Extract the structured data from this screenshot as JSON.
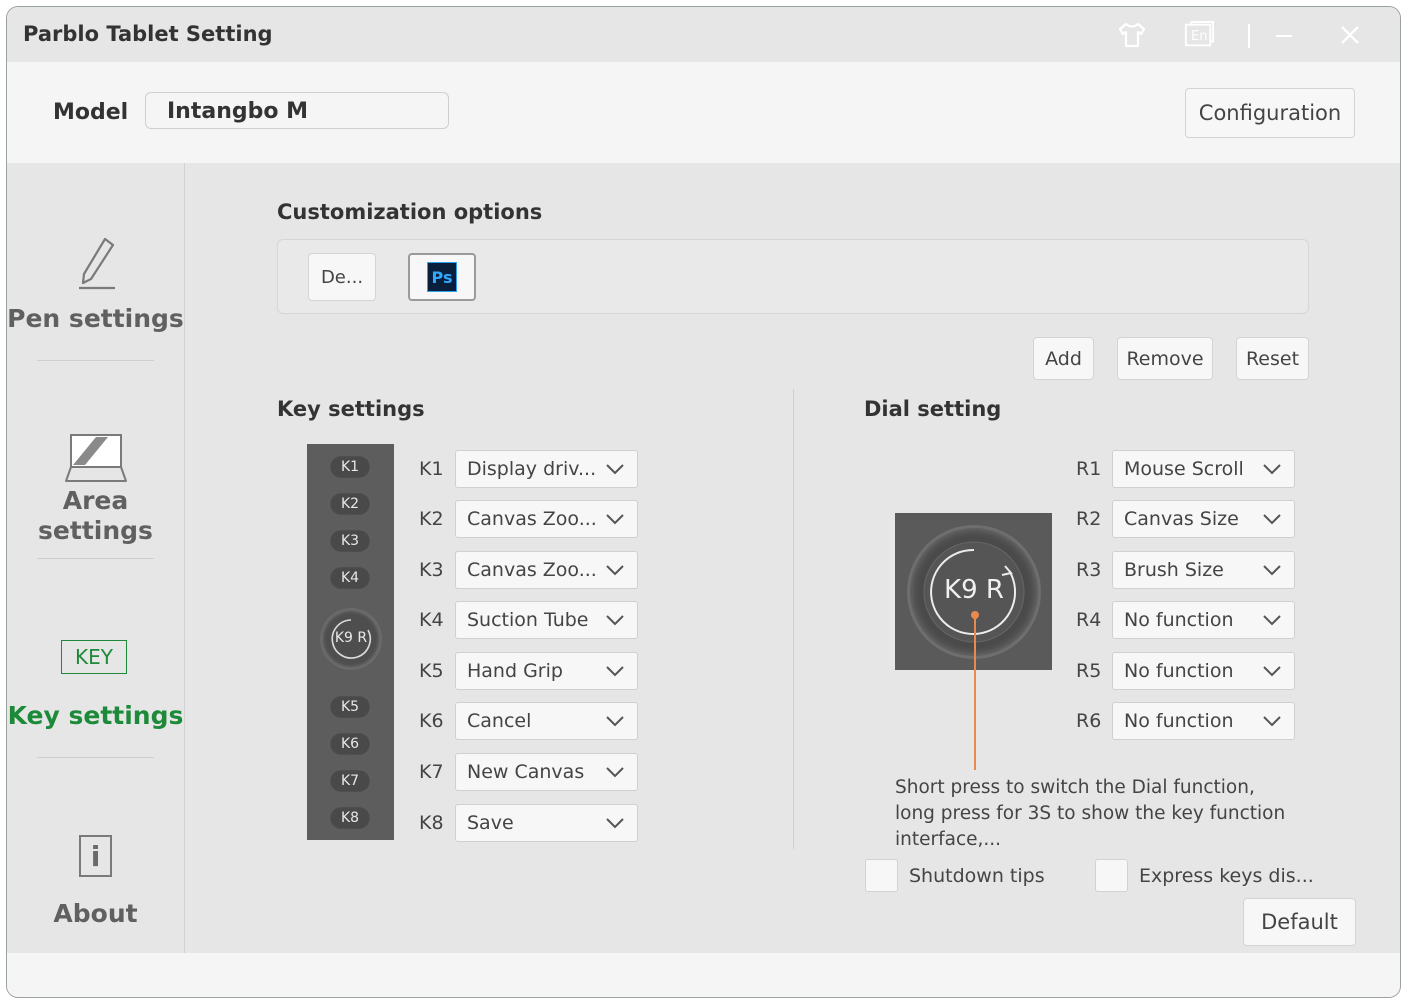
{
  "window": {
    "title": "Parblo Tablet Setting"
  },
  "titlebar_icons": [
    "skin-icon",
    "language-icon",
    "minimize-icon",
    "close-icon"
  ],
  "titlebar": {
    "language_badge": "En"
  },
  "header": {
    "model_label": "Model",
    "model_value": "Intangbo M",
    "configuration_label": "Configuration"
  },
  "sidebar": {
    "items": [
      {
        "id": "pen",
        "label": "Pen settings",
        "icon": "pen-icon",
        "active": false
      },
      {
        "id": "area",
        "label": "Area settings",
        "label_line1": "Area",
        "label_line2": "settings",
        "icon": "area-icon",
        "active": false
      },
      {
        "id": "key",
        "label": "Key settings",
        "icon": "key-icon",
        "icon_text": "KEY",
        "active": true
      },
      {
        "id": "about",
        "label": "About",
        "icon": "info-icon",
        "icon_text": "i",
        "active": false
      }
    ]
  },
  "customization": {
    "title": "Customization options",
    "apps": [
      {
        "label": "De...",
        "selected": false
      },
      {
        "label": "Ps",
        "icon": "photoshop-icon",
        "selected": true
      }
    ],
    "add_label": "Add",
    "remove_label": "Remove",
    "reset_label": "Reset"
  },
  "key_settings": {
    "title": "Key settings",
    "strip_keys": [
      "K1",
      "K2",
      "K3",
      "K4",
      "K9 R",
      "K5",
      "K6",
      "K7",
      "K8"
    ],
    "rows": [
      {
        "key": "K1",
        "value": "Display driv..."
      },
      {
        "key": "K2",
        "value": "Canvas Zoo..."
      },
      {
        "key": "K3",
        "value": "Canvas Zoo..."
      },
      {
        "key": "K4",
        "value": "Suction Tube"
      },
      {
        "key": "K5",
        "value": "Hand Grip"
      },
      {
        "key": "K6",
        "value": "Cancel"
      },
      {
        "key": "K7",
        "value": "New Canvas"
      },
      {
        "key": "K8",
        "value": "Save"
      }
    ]
  },
  "dial_setting": {
    "title": "Dial setting",
    "dial_label": "K9 R",
    "rows": [
      {
        "key": "R1",
        "value": "Mouse Scroll"
      },
      {
        "key": "R2",
        "value": "Canvas Size"
      },
      {
        "key": "R3",
        "value": "Brush Size"
      },
      {
        "key": "R4",
        "value": "No function"
      },
      {
        "key": "R5",
        "value": "No function"
      },
      {
        "key": "R6",
        "value": "No function"
      }
    ],
    "description_line1": "Short press to switch the Dial function,",
    "description_line2": "long press for 3S to show the key function",
    "description_line3": "interface,...",
    "shutdown_tips_label": "Shutdown tips",
    "express_keys_label": "Express keys dis...",
    "default_label": "Default"
  },
  "colors": {
    "accent": "#1d8a3a",
    "title_bar": "#e6e6e6",
    "panel": "#e6e6e6",
    "leader_line": "#e88a4e"
  }
}
